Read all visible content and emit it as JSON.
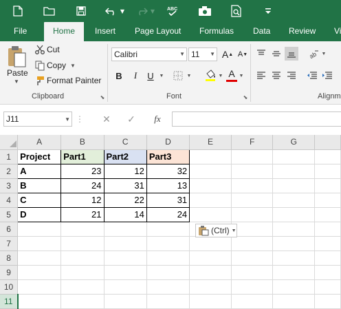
{
  "qat": {
    "icons": [
      "new-file-icon",
      "open-folder-icon",
      "save-icon",
      "undo-icon",
      "redo-icon",
      "spelling-icon",
      "camera-icon",
      "print-preview-icon",
      "customize-qat-icon"
    ]
  },
  "tabs": [
    "File",
    "Home",
    "Insert",
    "Page Layout",
    "Formulas",
    "Data",
    "Review",
    "Vi"
  ],
  "active_tab": "Home",
  "clipboard": {
    "paste_label": "Paste",
    "cut_label": "Cut",
    "copy_label": "Copy",
    "format_painter_label": "Format Painter",
    "group_label": "Clipboard"
  },
  "font": {
    "name": "Calibri",
    "size": "11",
    "grow_label": "A",
    "shrink_label": "A",
    "bold": "B",
    "italic": "I",
    "underline": "U",
    "font_color_label": "A",
    "group_label": "Font"
  },
  "alignment": {
    "group_label": "Alignm"
  },
  "formula_bar": {
    "name_box": "J11",
    "fx": "fx",
    "formula": ""
  },
  "sheet": {
    "columns": [
      "A",
      "B",
      "C",
      "D",
      "E",
      "F",
      "G"
    ],
    "rows": [
      "1",
      "2",
      "3",
      "4",
      "5",
      "6",
      "7",
      "8",
      "9",
      "10",
      "11"
    ],
    "header": [
      "Project",
      "Part1",
      "Part2",
      "Part3"
    ],
    "data": [
      [
        "A",
        "23",
        "12",
        "32"
      ],
      [
        "B",
        "24",
        "31",
        "13"
      ],
      [
        "C",
        "12",
        "22",
        "31"
      ],
      [
        "D",
        "21",
        "14",
        "24"
      ]
    ],
    "header_colors": {
      "A": "#ffffff",
      "B": "#e2efda",
      "C": "#d9e1f2",
      "D": "#fce4d6"
    },
    "selected_row": "11"
  },
  "paste_options": {
    "label": "(Ctrl)"
  },
  "colors": {
    "ribbon_green": "#217346",
    "font_color_red": "#e00000"
  }
}
